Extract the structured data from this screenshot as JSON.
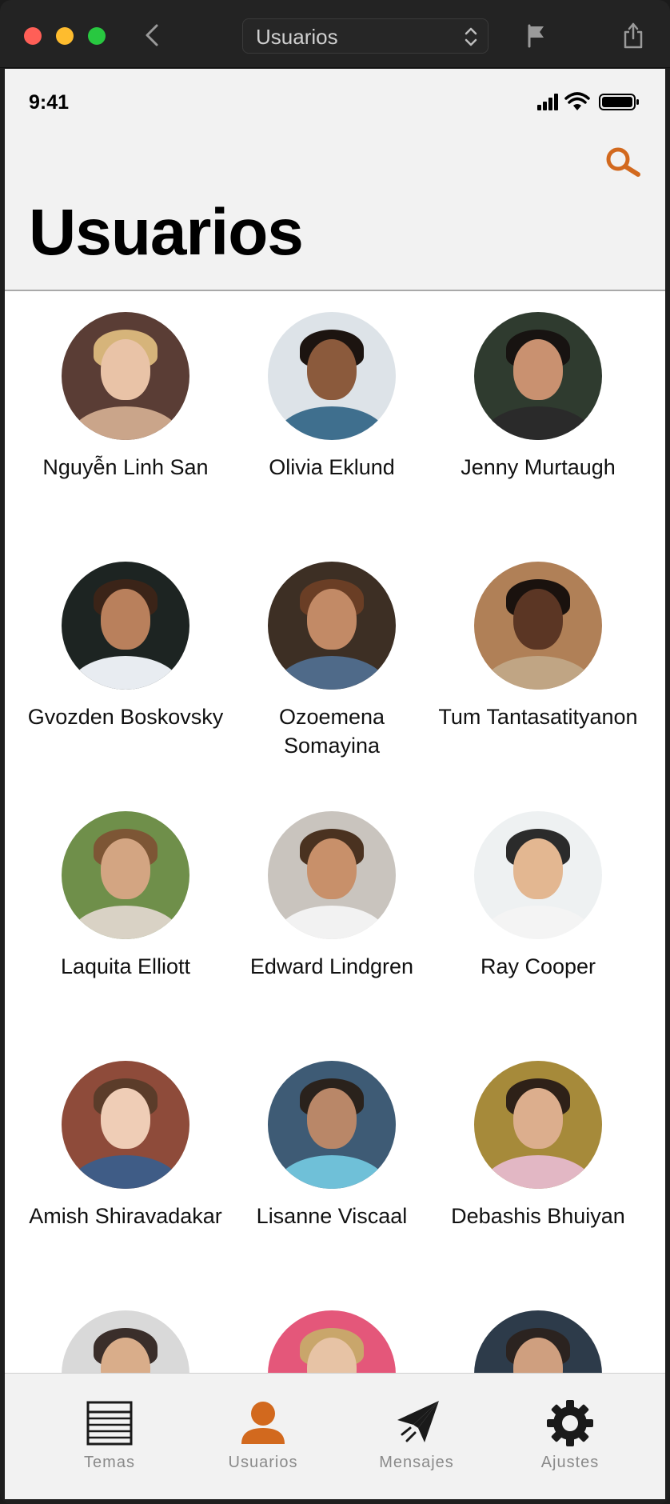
{
  "window": {
    "title_select": "Usuarios"
  },
  "status": {
    "time": "9:41"
  },
  "header": {
    "title": "Usuarios"
  },
  "users": [
    {
      "name": "Nguyễn Linh San",
      "skin": "#e9c3a7",
      "hair": "#d6b47a",
      "bg": "#5a3d35",
      "shirt": "#caa58a"
    },
    {
      "name": "Olivia Eklund",
      "skin": "#8b5a3c",
      "hair": "#1c1410",
      "bg": "#dde3e8",
      "shirt": "#3f6f8e"
    },
    {
      "name": "Jenny Murtaugh",
      "skin": "#c99170",
      "hair": "#171311",
      "bg": "#2f3b2f",
      "shirt": "#2a2a2a"
    },
    {
      "name": "Gvozden Boskovsky",
      "skin": "#b9805c",
      "hair": "#3b2418",
      "bg": "#1d2422",
      "shirt": "#e8ecf1"
    },
    {
      "name": "Ozoemena Somayina",
      "skin": "#c28a66",
      "hair": "#6a3e25",
      "bg": "#3d2f24",
      "shirt": "#4f6a89"
    },
    {
      "name": "Tum Tantasatityanon",
      "skin": "#5b3624",
      "hair": "#1a120e",
      "bg": "#b08057",
      "shirt": "#c0a584"
    },
    {
      "name": "Laquita Elliott",
      "skin": "#d3a582",
      "hair": "#7d5635",
      "bg": "#6f8f4a",
      "shirt": "#d9d2c5"
    },
    {
      "name": "Edward Lindgren",
      "skin": "#c8906a",
      "hair": "#4a3220",
      "bg": "#c9c4be",
      "shirt": "#f2f2f2"
    },
    {
      "name": "Ray Cooper",
      "skin": "#e3b791",
      "hair": "#2b2b2b",
      "bg": "#eef1f2",
      "shirt": "#f4f4f4"
    },
    {
      "name": "Amish Shiravadakar",
      "skin": "#efcdb6",
      "hair": "#5b3c2a",
      "bg": "#8e4b3a",
      "shirt": "#3f5c86"
    },
    {
      "name": "Lisanne Viscaal",
      "skin": "#b98768",
      "hair": "#2a221c",
      "bg": "#3e5b75",
      "shirt": "#6fc0d8"
    },
    {
      "name": "Debashis Bhuiyan",
      "skin": "#dcae8d",
      "hair": "#2e2118",
      "bg": "#a68a3a",
      "shirt": "#e2b7c4"
    },
    {
      "name": "",
      "skin": "#d9ad8a",
      "hair": "#3a2e2a",
      "bg": "#d9d9d9",
      "shirt": "#888888"
    },
    {
      "name": "",
      "skin": "#e7c3a5",
      "hair": "#c9a66b",
      "bg": "#e4577a",
      "shirt": "#e4577a"
    },
    {
      "name": "",
      "skin": "#cf9f7f",
      "hair": "#2b2320",
      "bg": "#2d3b4a",
      "shirt": "#2d3b4a"
    }
  ],
  "tabbar": {
    "tabs": [
      {
        "label": "Temas",
        "icon": "newspaper-icon"
      },
      {
        "label": "Usuarios",
        "icon": "person-icon"
      },
      {
        "label": "Mensajes",
        "icon": "paperplane-icon"
      },
      {
        "label": "Ajustes",
        "icon": "gear-icon"
      }
    ],
    "active_index": 1
  },
  "colors": {
    "accent": "#d2691e",
    "icon_dark": "#1a1a1a",
    "tab_label": "#8a8a8a"
  }
}
